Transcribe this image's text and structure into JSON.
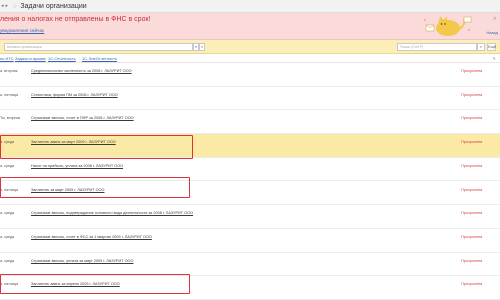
{
  "window": {
    "title": "Задачи организации",
    "controls": [
      "◂",
      "▸",
      "☆"
    ]
  },
  "banner": {
    "headline": "ления о налогах не отправлены в ФНС в срок!",
    "link": "уведомления сейчас",
    "close_glyph": "×",
    "next_label": "Назад"
  },
  "filter": {
    "org_placeholder": "вставки организации",
    "search_placeholder": "Поиск (Ctrl+F)",
    "dropdown_glyph": "▾",
    "clear_glyph": "×",
    "search_glyph": "⌕",
    "more_label": "Ещё"
  },
  "tabs": [
    "по ИТС",
    "Задачи в архиве",
    "1С-Отчетность",
    "1С-ЭлеОтчетность"
  ],
  "rows": [
    {
      "period": "а, вторник",
      "task": "Среднесписочная численность за 2008 г. ЛАЗУРИТ ООО",
      "status": "Просрочена",
      "highlighted": false
    },
    {
      "period": "а, пятница",
      "task": "Статистика, форма ПМ за 2008 г. ЛАЗУРИТ ООО",
      "status": "Просрочена",
      "highlighted": false
    },
    {
      "period": "Ты, вторник",
      "task": "Страховые взносы, отчет в ПФР за 2008 г. ЛАЗУРИТ ООО",
      "status": "Просрочена",
      "highlighted": false
    },
    {
      "period": "а, среда",
      "task": "Заплатить аванс за март 2009 г. ЛАЗУРИТ ООО",
      "status": "Просрочена",
      "highlighted": true
    },
    {
      "period": "а, среда",
      "task": "Налог на прибыль, уплата за 2008 г. ЛАЗУРИТ ООО",
      "status": "Просрочена",
      "highlighted": false
    },
    {
      "period": "а, пятница",
      "task": "Заплатить за март 2009 г. ЛАЗУРИТ ООО",
      "status": "Просрочена",
      "highlighted": false
    },
    {
      "period": "а, среда",
      "task": "Страховые взносы, подтверждение основного вида деятельности за 2008 г. ЛАЗУРИТ ООО",
      "status": "Просрочена",
      "highlighted": false
    },
    {
      "period": "а, среда",
      "task": "Страховые взносы, отчет в ФСС за 1 квартал 2009 г. ЛАЗУРИТ ООО",
      "status": "Просрочена",
      "highlighted": false
    },
    {
      "period": "а, среда",
      "task": "Страховые взносы, уплата за март 2009 г. ЛАЗУРИТ ООО",
      "status": "Просрочена",
      "highlighted": false
    },
    {
      "period": "а, пятница",
      "task": "Заплатить аванс за апрель 2009 г. ЛАЗУРИТ ООО",
      "status": "Просрочена",
      "highlighted": false
    }
  ],
  "annotation_color": "#d9343b",
  "accent_colors": {
    "banner_bg": "#fbdada",
    "filter_bg": "#fbeeb8",
    "selected_row": "#fbe9a6",
    "overdue": "#d03a3a",
    "link": "#3a67b3"
  }
}
